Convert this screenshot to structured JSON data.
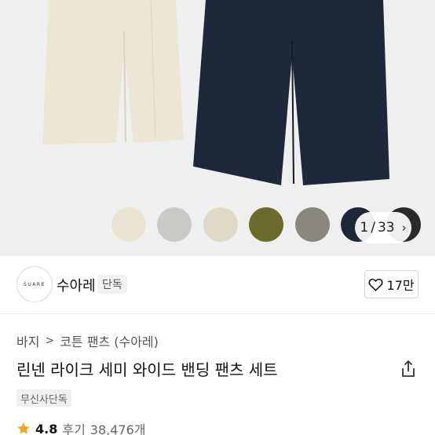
{
  "gallery": {
    "swatch_colors": [
      "#e8e3d2",
      "#c9cbc7",
      "#dfdac7",
      "#6b6b2c",
      "#8a877e",
      "#1e2735",
      "#2a2a2a"
    ],
    "counter_current": "1",
    "counter_total": "33",
    "counter_separator": "/"
  },
  "brand": {
    "logo_text": "SUARE",
    "name": "수아레",
    "badge": "단독",
    "likes": "17만"
  },
  "breadcrumb": {
    "items": [
      "바지",
      "코튼 팬츠 (수아레)"
    ]
  },
  "product": {
    "title": "린넨 라이크 세미 와이드 밴딩 팬츠 세트",
    "tag": "무신사단독"
  },
  "rating": {
    "score": "4.8",
    "review_label": "후기",
    "review_count": "38,476개"
  },
  "colors": {
    "star": "#f5a623",
    "beige_pants": "#ece7d8",
    "navy_pants": "#1f2838"
  }
}
